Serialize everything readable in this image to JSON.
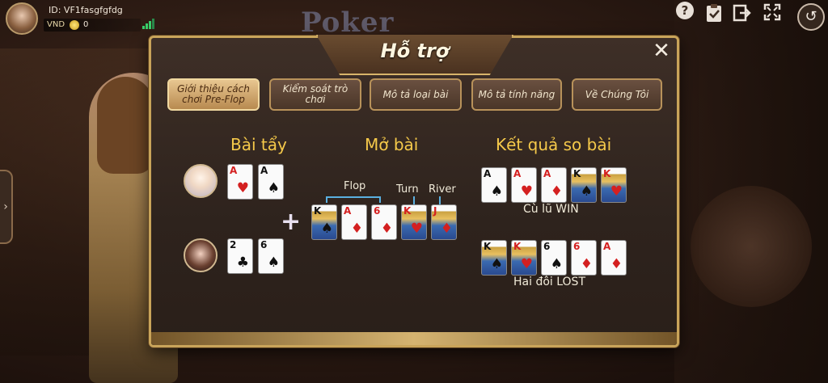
{
  "hud": {
    "user_id": "ID: VF1fasgfgfdg",
    "currency": "VND",
    "balance": "0"
  },
  "background": {
    "logo_text": "Poker"
  },
  "dialog": {
    "title": "Hỗ trợ",
    "close_symbol": "✕",
    "tabs": [
      {
        "label": "Giới thiệu cách chơi Pre-Flop",
        "active": true
      },
      {
        "label": "Kiểm soát trò chơi",
        "active": false
      },
      {
        "label": "Mô tả loại bài",
        "active": false
      },
      {
        "label": "Mô tả tính năng",
        "active": false
      },
      {
        "label": "Về Chúng Tôi",
        "active": false
      }
    ],
    "columns": {
      "hole_cards": "Bài tẩy",
      "open_cards": "Mở bài",
      "result": "Kết quả so bài"
    },
    "board_labels": {
      "flop": "Flop",
      "turn": "Turn",
      "river": "River"
    },
    "player1_cards": [
      {
        "rank": "A",
        "suit": "♥",
        "color": "red"
      },
      {
        "rank": "A",
        "suit": "♠",
        "color": "black"
      }
    ],
    "player2_cards": [
      {
        "rank": "2",
        "suit": "♣",
        "color": "black"
      },
      {
        "rank": "6",
        "suit": "♠",
        "color": "black"
      }
    ],
    "board_cards": [
      {
        "rank": "K",
        "suit": "♠",
        "color": "black",
        "face": true
      },
      {
        "rank": "A",
        "suit": "♦",
        "color": "red"
      },
      {
        "rank": "6",
        "suit": "♦",
        "color": "red"
      },
      {
        "rank": "K",
        "suit": "♥",
        "color": "red",
        "face": true
      },
      {
        "rank": "J",
        "suit": "♦",
        "color": "red",
        "face": true
      }
    ],
    "result_win_cards": [
      {
        "rank": "A",
        "suit": "♠",
        "color": "black"
      },
      {
        "rank": "A",
        "suit": "♥",
        "color": "red"
      },
      {
        "rank": "A",
        "suit": "♦",
        "color": "red"
      },
      {
        "rank": "K",
        "suit": "♠",
        "color": "black",
        "face": true
      },
      {
        "rank": "K",
        "suit": "♥",
        "color": "red",
        "face": true
      }
    ],
    "result_lost_cards": [
      {
        "rank": "K",
        "suit": "♠",
        "color": "black",
        "face": true
      },
      {
        "rank": "K",
        "suit": "♥",
        "color": "red",
        "face": true
      },
      {
        "rank": "6",
        "suit": "♠",
        "color": "black"
      },
      {
        "rank": "6",
        "suit": "♦",
        "color": "red"
      },
      {
        "rank": "A",
        "suit": "♦",
        "color": "red"
      }
    ],
    "result_win_label": "Cù lũ WIN",
    "result_lost_label": "Hai đôi LOST"
  },
  "icons": {
    "help": "?",
    "clipboard": "📋",
    "exit": "⇱",
    "fullscreen": "⛶",
    "back": "↺",
    "side_arrow": "›"
  },
  "colors": {
    "accent": "#f5c94a",
    "frame": "#c9a45a",
    "bracket": "#5ab0e0"
  }
}
